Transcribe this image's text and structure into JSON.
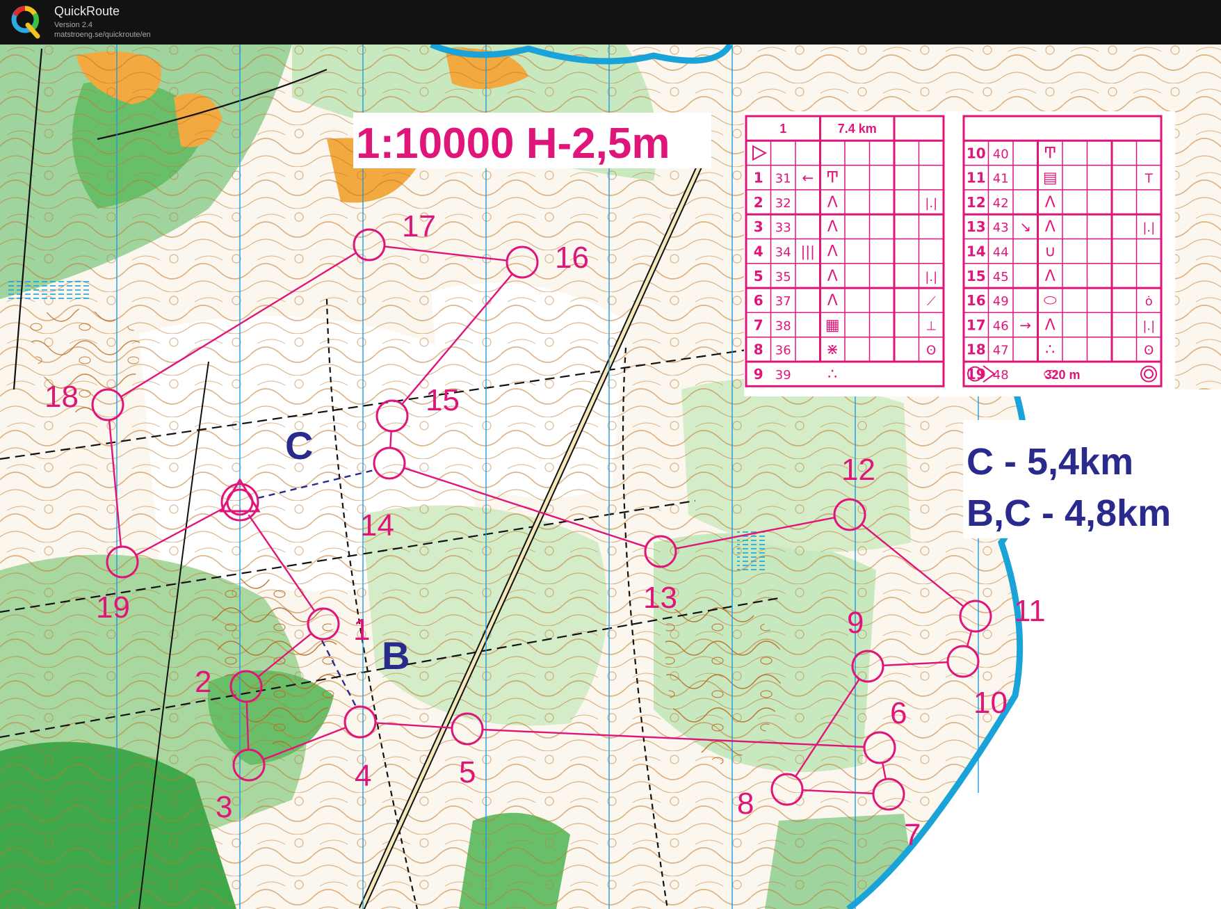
{
  "app": {
    "name": "QuickRoute",
    "version": "Version 2.4",
    "url": "matstroeng.se/quickroute/en",
    "logo_letter": "Q"
  },
  "map": {
    "scale_label": "1:10000  H-2,5m",
    "course_c_length": "C - 5,4km",
    "course_bc_length": "B,C - 4,8km",
    "course_label_c": "C",
    "course_label_b": "B",
    "colors": {
      "course": "#e0157a",
      "course_label": "#2a2a8c",
      "contour": "#c2782d",
      "vegetation": "#69bf69",
      "open_land": "#f2a93f",
      "water": "#1aa3d9",
      "magnetic_north": "#1e9be0"
    },
    "controls": [
      {
        "n": "1",
        "label": "1"
      },
      {
        "n": "2",
        "label": "2"
      },
      {
        "n": "3",
        "label": "3"
      },
      {
        "n": "4",
        "label": "4"
      },
      {
        "n": "5",
        "label": "5"
      },
      {
        "n": "6",
        "label": "6"
      },
      {
        "n": "7",
        "label": "7"
      },
      {
        "n": "8",
        "label": "8"
      },
      {
        "n": "9",
        "label": "9"
      },
      {
        "n": "10",
        "label": "10"
      },
      {
        "n": "11",
        "label": "11"
      },
      {
        "n": "12",
        "label": "12"
      },
      {
        "n": "13",
        "label": "13"
      },
      {
        "n": "14",
        "label": "14"
      },
      {
        "n": "15",
        "label": "15"
      },
      {
        "n": "16",
        "label": "16"
      },
      {
        "n": "17",
        "label": "17"
      },
      {
        "n": "18",
        "label": "18"
      },
      {
        "n": "19",
        "label": "19"
      }
    ]
  },
  "control_descriptions": {
    "header": {
      "event": "1",
      "length": "7.4 km"
    },
    "finish_distance": "320 m",
    "rows": [
      {
        "seq": "1",
        "code": "31",
        "direction": "←",
        "feature": "Ͳ",
        "extra": ""
      },
      {
        "seq": "2",
        "code": "32",
        "direction": "",
        "feature": "Λ",
        "extra": "|.|"
      },
      {
        "seq": "3",
        "code": "33",
        "direction": "",
        "feature": "Λ",
        "extra": ""
      },
      {
        "seq": "4",
        "code": "34",
        "direction": "|||",
        "feature": "Λ",
        "extra": ""
      },
      {
        "seq": "5",
        "code": "35",
        "direction": "",
        "feature": "Λ",
        "extra": "|.|"
      },
      {
        "seq": "6",
        "code": "37",
        "direction": "",
        "feature": "Λ",
        "extra": "⟋"
      },
      {
        "seq": "7",
        "code": "38",
        "direction": "",
        "feature": "▦",
        "extra": "⊥"
      },
      {
        "seq": "8",
        "code": "36",
        "direction": "",
        "feature": "⋇",
        "extra": "ʘ"
      },
      {
        "seq": "9",
        "code": "39",
        "direction": "",
        "feature": "∴",
        "extra": ""
      },
      {
        "seq": "10",
        "code": "40",
        "direction": "",
        "feature": "Ͳ",
        "extra": ""
      },
      {
        "seq": "11",
        "code": "41",
        "direction": "",
        "feature": "▤",
        "extra": "T"
      },
      {
        "seq": "12",
        "code": "42",
        "direction": "",
        "feature": "Λ",
        "extra": ""
      },
      {
        "seq": "13",
        "code": "43",
        "direction": "↘",
        "feature": "Λ",
        "extra": "|.|"
      },
      {
        "seq": "14",
        "code": "44",
        "direction": "",
        "feature": "∪",
        "extra": ""
      },
      {
        "seq": "15",
        "code": "45",
        "direction": "",
        "feature": "Λ",
        "extra": ""
      },
      {
        "seq": "16",
        "code": "49",
        "direction": "",
        "feature": "⬭",
        "extra": "ȯ"
      },
      {
        "seq": "17",
        "code": "46",
        "direction": "→",
        "feature": "Λ",
        "extra": "|.|"
      },
      {
        "seq": "18",
        "code": "47",
        "direction": "",
        "feature": "∴",
        "extra": "ʘ"
      },
      {
        "seq": "19",
        "code": "48",
        "direction": "",
        "feature": "⬭",
        "extra": ""
      }
    ]
  }
}
